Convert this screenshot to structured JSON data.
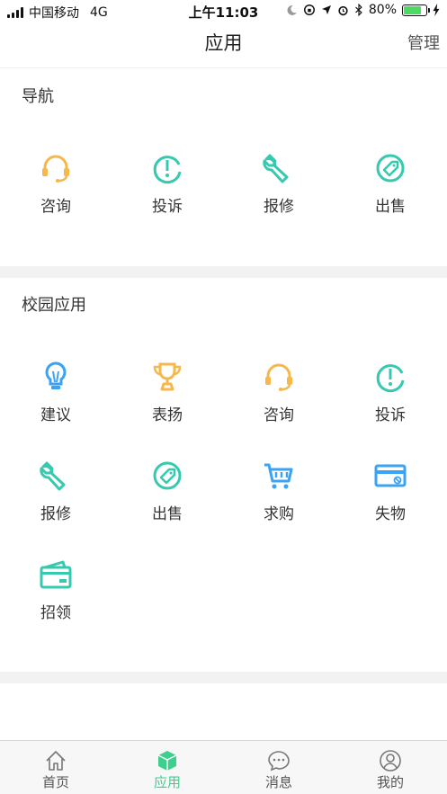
{
  "status_bar": {
    "carrier": "中国移动",
    "network": "4G",
    "time": "上午11:03",
    "battery": "80%",
    "battery_level": 0.8
  },
  "nav": {
    "title": "应用",
    "manage": "管理"
  },
  "sections": {
    "navigation": {
      "title": "导航",
      "items": [
        {
          "label": "咨询",
          "icon": "headset-icon"
        },
        {
          "label": "投诉",
          "icon": "complaint-icon"
        },
        {
          "label": "报修",
          "icon": "wrench-icon"
        },
        {
          "label": "出售",
          "icon": "price-tag-icon"
        }
      ]
    },
    "campus": {
      "title": "校园应用",
      "items": [
        {
          "label": "建议",
          "icon": "lightbulb-icon"
        },
        {
          "label": "表扬",
          "icon": "trophy-icon"
        },
        {
          "label": "咨询",
          "icon": "headset-icon"
        },
        {
          "label": "投诉",
          "icon": "complaint-icon"
        },
        {
          "label": "报修",
          "icon": "wrench-icon"
        },
        {
          "label": "出售",
          "icon": "price-tag-icon"
        },
        {
          "label": "求购",
          "icon": "cart-icon"
        },
        {
          "label": "失物",
          "icon": "lost-card-icon"
        },
        {
          "label": "招领",
          "icon": "found-card-icon"
        }
      ]
    }
  },
  "tab_bar": {
    "items": [
      {
        "label": "首页",
        "icon": "home-icon"
      },
      {
        "label": "应用",
        "icon": "cube-icon"
      },
      {
        "label": "消息",
        "icon": "chat-bubble-icon"
      },
      {
        "label": "我的",
        "icon": "user-icon"
      }
    ],
    "active_index": 1
  },
  "colors": {
    "accent_green": "#3ecf8e",
    "teal": "#36c9b0",
    "orange": "#f7b84b",
    "blue": "#3aa3f5"
  }
}
